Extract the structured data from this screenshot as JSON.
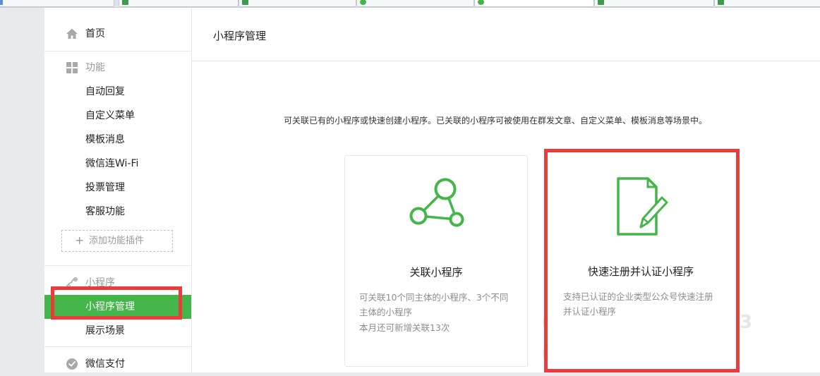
{
  "colors": {
    "accent": "#44b549",
    "highlight": "#ee3a3a",
    "muted_text": "#8d8d8d",
    "icon_gray": "#a8a8a8"
  },
  "sidebar": {
    "home": {
      "label": "首页",
      "icon": "home-icon"
    },
    "features": {
      "label": "功能",
      "icon": "grid-icon",
      "items": [
        "自动回复",
        "自定义菜单",
        "模板消息",
        "微信连Wi-Fi",
        "投票管理",
        "客服功能"
      ],
      "add_plugin": "添加功能插件"
    },
    "mini_program": {
      "label": "小程序",
      "icon": "mini-program-icon",
      "items": [
        "小程序管理",
        "展示场景"
      ],
      "active": "小程序管理"
    },
    "payment": {
      "label": "微信支付",
      "icon": "wechat-pay-icon"
    }
  },
  "main": {
    "title": "小程序管理",
    "intro": "可关联已有的小程序或快速创建小程序。已关联的小程序可被使用在群发文章、自定义菜单、模板消息等场景中。",
    "cards": [
      {
        "title": "关联小程序",
        "icon": "link-nodes-icon",
        "desc": "可关联10个同主体的小程序、3个不同主体的小程序",
        "note": "本月还可新增关联13次"
      },
      {
        "title": "快速注册并认证小程序",
        "icon": "document-edit-icon",
        "desc": "支持已认证的企业类型公众号快速注册并认证小程序"
      }
    ]
  }
}
